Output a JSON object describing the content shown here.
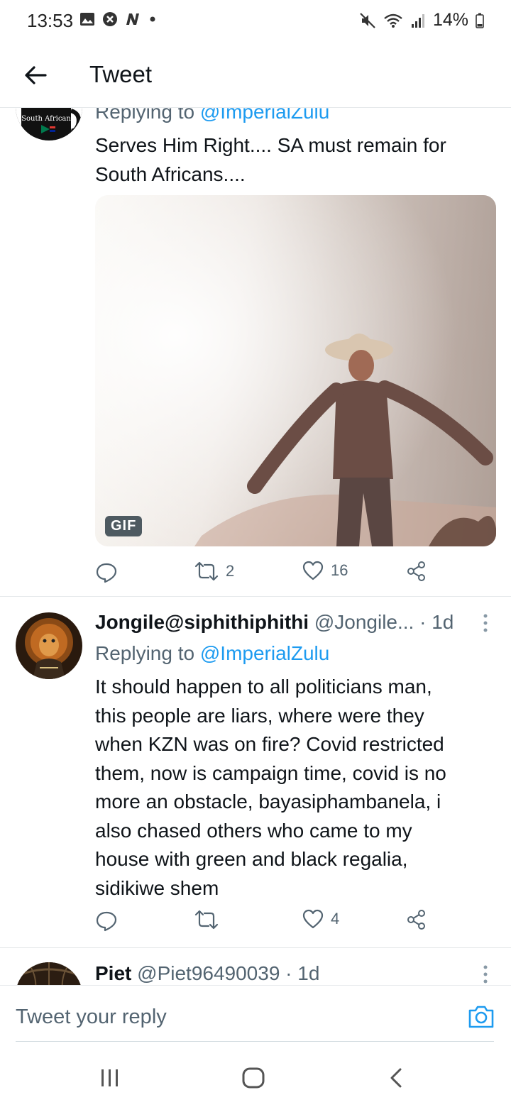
{
  "status_bar": {
    "time": "13:53",
    "battery": "14%"
  },
  "header": {
    "title": "Tweet"
  },
  "tweet1": {
    "replying_prefix": "Replying to ",
    "replying_handle": "@ImperialZulu",
    "text_line1": "Serves Him Right.... SA must remain for",
    "text_line2": "South Africans....",
    "gif_label": "GIF",
    "retweets": "2",
    "likes": "16",
    "avatar_text": "South African"
  },
  "tweet2": {
    "name": "Jongile@siphithiphithi",
    "handle": "@Jongile...",
    "time": "· 1d",
    "replying_prefix": "Replying to ",
    "replying_handle": "@ImperialZulu",
    "lines": [
      "It should happen to all politicians man,",
      "this people are liars, where were they",
      "when KZN was on fire? Covid restricted",
      "them, now is campaign time, covid is no",
      "more an obstacle, bayasiphambanela, i",
      "also chased others who came to my",
      "house with green and black regalia,",
      "sidikiwe shem"
    ],
    "likes": "4"
  },
  "tweet3": {
    "name": "Piet",
    "handle": "@Piet96490039",
    "time": "· 1d"
  },
  "composer": {
    "placeholder": "Tweet your reply"
  },
  "colors": {
    "accent": "#1d9bf0",
    "secondary_text": "#536471"
  }
}
